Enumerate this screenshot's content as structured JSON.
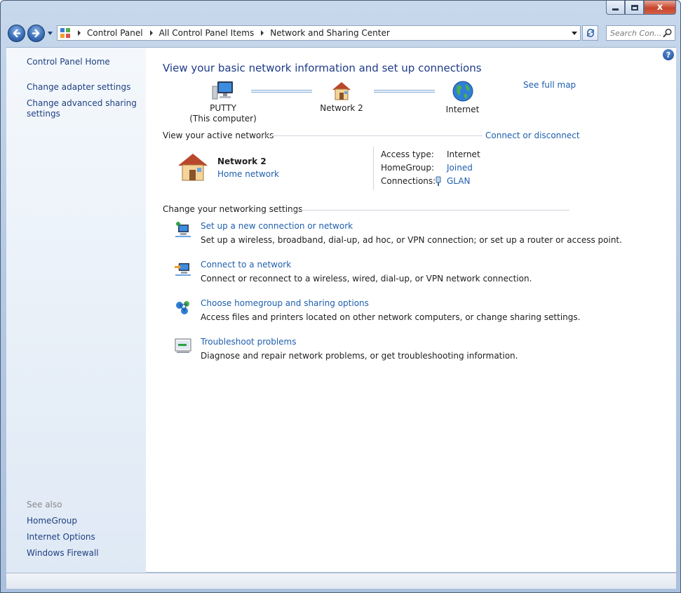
{
  "window": {
    "controls": {
      "minimize": "minimize",
      "maximize": "maximize",
      "close": "x"
    }
  },
  "nav": {
    "breadcrumbs": [
      "Control Panel",
      "All Control Panel Items",
      "Network and Sharing Center"
    ],
    "search_placeholder": "Search Con..."
  },
  "sidebar": {
    "home": "Control Panel Home",
    "links": [
      "Change adapter settings",
      "Change advanced sharing settings"
    ],
    "see_also_label": "See also",
    "see_also": [
      "HomeGroup",
      "Internet Options",
      "Windows Firewall"
    ]
  },
  "main": {
    "title": "View your basic network information and set up connections",
    "see_full_map": "See full map",
    "map": {
      "computer_name": "PUTTY",
      "computer_sub": "(This computer)",
      "network_name": "Network  2",
      "internet": "Internet"
    },
    "active_networks": {
      "heading": "View your active networks",
      "connect_link": "Connect or disconnect",
      "network_name": "Network  2",
      "network_type": "Home network",
      "access_type_label": "Access type:",
      "access_type_value": "Internet",
      "homegroup_label": "HomeGroup:",
      "homegroup_value": "Joined",
      "connections_label": "Connections:",
      "connections_value": "GLAN"
    },
    "settings": {
      "heading": "Change your networking settings",
      "tasks": [
        {
          "title": "Set up a new connection or network",
          "desc": "Set up a wireless, broadband, dial-up, ad hoc, or VPN connection; or set up a router or access point.",
          "icon": "new-connection-icon"
        },
        {
          "title": "Connect to a network",
          "desc": "Connect or reconnect to a wireless, wired, dial-up, or VPN network connection.",
          "icon": "connect-network-icon"
        },
        {
          "title": "Choose homegroup and sharing options",
          "desc": "Access files and printers located on other network computers, or change sharing settings.",
          "icon": "homegroup-icon"
        },
        {
          "title": "Troubleshoot problems",
          "desc": "Diagnose and repair network problems, or get troubleshooting information.",
          "icon": "troubleshoot-icon"
        }
      ]
    }
  },
  "colors": {
    "link": "#1e5fae",
    "title": "#1e3b8a",
    "sidebar_link": "#1e3f80"
  }
}
